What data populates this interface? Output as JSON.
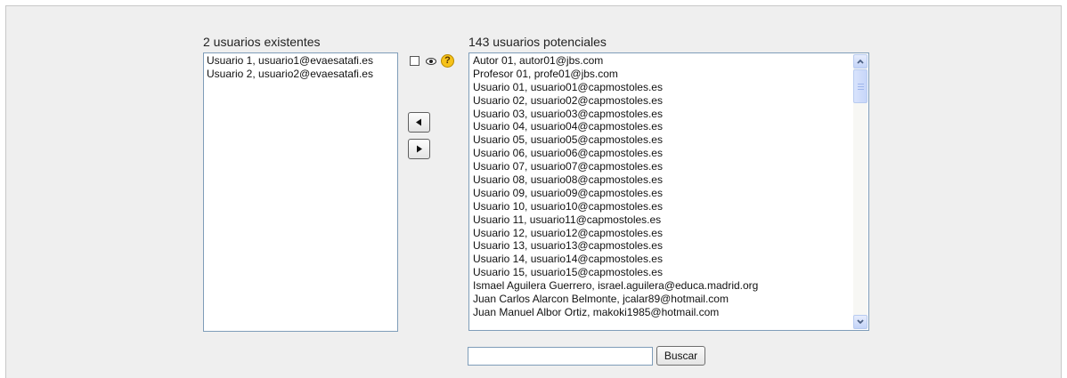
{
  "existing": {
    "heading": "2 usuarios existentes",
    "items": [
      "Usuario 1, usuario1@evaesatafi.es",
      "Usuario 2, usuario2@evaesatafi.es"
    ]
  },
  "potential": {
    "heading": "143 usuarios potenciales",
    "items": [
      "Autor 01, autor01@jbs.com",
      "Profesor 01, profe01@jbs.com",
      "Usuario 01, usuario01@capmostoles.es",
      "Usuario 02, usuario02@capmostoles.es",
      "Usuario 03, usuario03@capmostoles.es",
      "Usuario 04, usuario04@capmostoles.es",
      "Usuario 05, usuario05@capmostoles.es",
      "Usuario 06, usuario06@capmostoles.es",
      "Usuario 07, usuario07@capmostoles.es",
      "Usuario 08, usuario08@capmostoles.es",
      "Usuario 09, usuario09@capmostoles.es",
      "Usuario 10, usuario10@capmostoles.es",
      "Usuario 11, usuario11@capmostoles.es",
      "Usuario 12, usuario12@capmostoles.es",
      "Usuario 13, usuario13@capmostoles.es",
      "Usuario 14, usuario14@capmostoles.es",
      "Usuario 15, usuario15@capmostoles.es",
      "Ismael Aguilera Guerrero, israel.aguilera@educa.madrid.org",
      "Juan Carlos Alarcon Belmonte, jcalar89@hotmail.com",
      "Juan Manuel Albor Ortiz, makoki1985@hotmail.com"
    ]
  },
  "controls": {
    "show_all_checked": false,
    "add_icon": "arrow-left-icon",
    "remove_icon": "arrow-right-icon",
    "eye_icon": "eye-icon",
    "help_icon": "help-icon",
    "help_glyph": "?"
  },
  "search": {
    "value": "",
    "button_label": "Buscar"
  },
  "colors": {
    "panel_background": "#efefef",
    "listbox_border": "#7f9db9",
    "help_icon": "#f6c21a"
  }
}
